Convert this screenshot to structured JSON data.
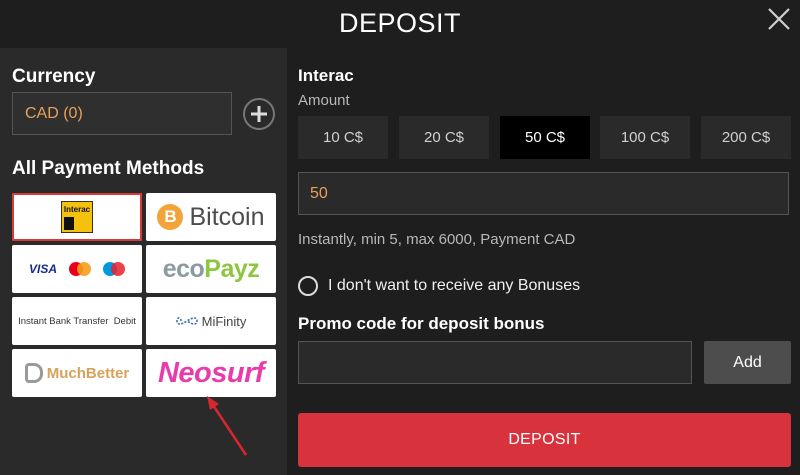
{
  "header": {
    "title": "DEPOSIT"
  },
  "sidebar": {
    "currency_label": "Currency",
    "currency_value": "CAD (0)",
    "methods_label": "All Payment Methods",
    "methods": [
      {
        "name": "Interac",
        "logo_text": "Interac",
        "selected": true
      },
      {
        "name": "Bitcoin",
        "logo_text": "Bitcoin",
        "coin": "B"
      },
      {
        "name": "Cards",
        "logo_text": "VISA"
      },
      {
        "name": "ecoPayz",
        "logo_text_a": "eco",
        "logo_text_b": "Payz"
      },
      {
        "name": "Instant Bank Transfer",
        "logo_text": "Instant Bank Transfer",
        "logo_text_b": "Debit"
      },
      {
        "name": "MiFinity",
        "logo_text": "MiFinity"
      },
      {
        "name": "MuchBetter",
        "logo_text": "MuchBetter"
      },
      {
        "name": "Neosurf",
        "logo_text": "Neosurf"
      }
    ]
  },
  "main": {
    "method_title": "Interac",
    "amount_label": "Amount",
    "chips": [
      "10 C$",
      "20 C$",
      "50 C$",
      "100 C$",
      "200 C$"
    ],
    "active_chip": 2,
    "amount_value": "50",
    "info": "Instantly, min 5, max 6000, Payment CAD",
    "no_bonus_label": "I don't want to receive any Bonuses",
    "promo_title": "Promo code for deposit bonus",
    "promo_placeholder": "",
    "add_label": "Add",
    "deposit_label": "DEPOSIT"
  },
  "colors": {
    "accent_red": "#d8323c",
    "amount_orange": "#e8a05a",
    "panel_dark": "#1e1e1e",
    "panel_left": "#2a2a2a"
  }
}
